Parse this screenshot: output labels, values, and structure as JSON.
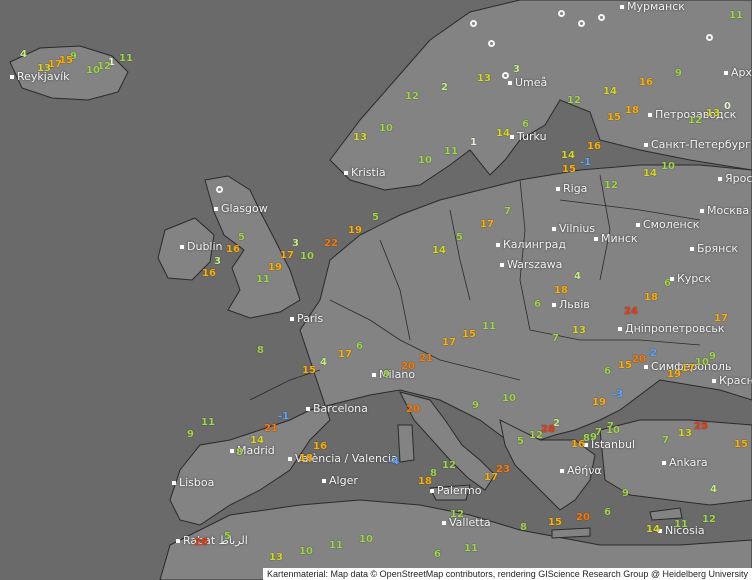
{
  "map": {
    "attribution": "Kartenmaterial: Map data © OpenStreetMap contributors, rendering GIScience Research Group @ Heidelberg University",
    "colors": {
      "sea": "#6a6a6a",
      "land": "#838383",
      "border": "#2a2a2a",
      "label": "#f2f2f2",
      "negative": "#5aa8ff",
      "cool": "#c6ee80",
      "mild": "#9fd64a",
      "warm": "#ffb000",
      "hot": "#f03a10"
    },
    "cities": [
      {
        "id": "reykjavik",
        "label": "Reykjavík"
      },
      {
        "id": "murmansk",
        "label": "Мурманск"
      },
      {
        "id": "arkhangelsk",
        "label": "Арха"
      },
      {
        "id": "petrozavodsk",
        "label": "Петрозаводск"
      },
      {
        "id": "umea",
        "label": "Umeå"
      },
      {
        "id": "turku",
        "label": "Turku"
      },
      {
        "id": "st-petersburg",
        "label": "Санкт-Петербург"
      },
      {
        "id": "kristiansand",
        "label": "Kristia"
      },
      {
        "id": "riga",
        "label": "Riga"
      },
      {
        "id": "yaroslavl",
        "label": "Яросл"
      },
      {
        "id": "glasgow",
        "label": "Glasgow"
      },
      {
        "id": "vilnius",
        "label": "Vilnius"
      },
      {
        "id": "minsk",
        "label": "Минск"
      },
      {
        "id": "smolensk",
        "label": "Смоленск"
      },
      {
        "id": "moskva",
        "label": "Москва"
      },
      {
        "id": "dublin",
        "label": "Dublin"
      },
      {
        "id": "bryansk",
        "label": "Брянск"
      },
      {
        "id": "kaliningrad",
        "label": "Калинград"
      },
      {
        "id": "warszawa",
        "label": "Warszawa"
      },
      {
        "id": "kursk",
        "label": "Курск"
      },
      {
        "id": "lviv",
        "label": "Львів"
      },
      {
        "id": "paris",
        "label": "Paris"
      },
      {
        "id": "dnipropetrovsk",
        "label": "Дніпропетровськ"
      },
      {
        "id": "simferopol",
        "label": "Симферополь"
      },
      {
        "id": "krasnodar",
        "label": "Красно"
      },
      {
        "id": "milano",
        "label": "Milano"
      },
      {
        "id": "barcelona",
        "label": "Barcelona"
      },
      {
        "id": "madrid",
        "label": "Madrid"
      },
      {
        "id": "valencia",
        "label": "València / Valencia"
      },
      {
        "id": "istanbul",
        "label": "İstanbul"
      },
      {
        "id": "ankara",
        "label": "Ankara"
      },
      {
        "id": "lisboa",
        "label": "Lisboa"
      },
      {
        "id": "palermo",
        "label": "Palermo"
      },
      {
        "id": "athina",
        "label": "Αθήνα"
      },
      {
        "id": "alger",
        "label": "Alger"
      },
      {
        "id": "valletta",
        "label": "Valletta"
      },
      {
        "id": "rabat",
        "label": "Rabat الرباط"
      },
      {
        "id": "nicosia",
        "label": "Nicosia"
      }
    ],
    "observations": [
      {
        "v": "4",
        "c": "c1"
      },
      {
        "v": "3",
        "c": "c1"
      },
      {
        "v": "6",
        "c": "c2"
      },
      {
        "v": "-1",
        "c": "neg"
      },
      {
        "v": "5",
        "c": "c2"
      },
      {
        "v": "7",
        "c": "c2"
      },
      {
        "v": "4",
        "c": "c1"
      },
      {
        "v": "6",
        "c": "c2"
      },
      {
        "v": "-3",
        "c": "neg"
      },
      {
        "v": "-2",
        "c": "neg"
      },
      {
        "v": "-1",
        "c": "neg"
      },
      {
        "v": "-4",
        "c": "neg"
      },
      {
        "v": "2",
        "c": "c1"
      },
      {
        "v": "4",
        "c": "c1"
      },
      {
        "v": "5",
        "c": "c2"
      },
      {
        "v": "6",
        "c": "c2"
      },
      {
        "v": "9",
        "c": "c2"
      },
      {
        "v": "9",
        "c": "c2"
      },
      {
        "v": "10",
        "c": "c2"
      },
      {
        "v": "10",
        "c": "c2"
      },
      {
        "v": "3",
        "c": "c1"
      },
      {
        "v": "5",
        "c": "c2"
      },
      {
        "v": "6",
        "c": "c2"
      },
      {
        "v": "8",
        "c": "c2"
      },
      {
        "v": "10",
        "c": "c2"
      },
      {
        "v": "9",
        "c": "c2"
      },
      {
        "v": "11",
        "c": "c2"
      },
      {
        "v": "12",
        "c": "c2"
      },
      {
        "v": "7",
        "c": "c2"
      },
      {
        "v": "9",
        "c": "c2"
      },
      {
        "v": "10",
        "c": "c2"
      },
      {
        "v": "12",
        "c": "c2"
      },
      {
        "v": "11",
        "c": "c2"
      },
      {
        "v": "13",
        "c": "c3"
      },
      {
        "v": "14",
        "c": "c3"
      },
      {
        "v": "15",
        "c": "w1"
      },
      {
        "v": "16",
        "c": "w1"
      },
      {
        "v": "17",
        "c": "w1"
      },
      {
        "v": "18",
        "c": "w1"
      },
      {
        "v": "17",
        "c": "w1"
      },
      {
        "v": "19",
        "c": "w1"
      },
      {
        "v": "20",
        "c": "w2"
      },
      {
        "v": "21",
        "c": "w2"
      },
      {
        "v": "23",
        "c": "w2"
      },
      {
        "v": "28",
        "c": "w3"
      },
      {
        "v": "25",
        "c": "w3"
      },
      {
        "v": "26",
        "c": "w3"
      },
      {
        "v": "20",
        "c": "w2"
      },
      {
        "v": "15",
        "c": "w1"
      },
      {
        "v": "16",
        "c": "w1"
      },
      {
        "v": "13",
        "c": "c3"
      },
      {
        "v": "14",
        "c": "c3"
      },
      {
        "v": "17",
        "c": "w1"
      },
      {
        "v": "19",
        "c": "w1"
      },
      {
        "v": "18",
        "c": "w1"
      },
      {
        "v": "21",
        "c": "w2"
      },
      {
        "v": "11",
        "c": "c2"
      },
      {
        "v": "10",
        "c": "c2"
      },
      {
        "v": "9",
        "c": "c2"
      },
      {
        "v": "8",
        "c": "c2"
      },
      {
        "v": "7",
        "c": "c2"
      },
      {
        "v": "10",
        "c": "c2"
      },
      {
        "v": "11",
        "c": "c2"
      },
      {
        "v": "12",
        "c": "c2"
      },
      {
        "v": "1",
        "c": "c0"
      },
      {
        "v": "2",
        "c": "c1"
      },
      {
        "v": "1",
        "c": "c0"
      },
      {
        "v": "0",
        "c": "c0"
      },
      {
        "v": "3",
        "c": "c1"
      },
      {
        "v": "5",
        "c": "c2"
      },
      {
        "v": "6",
        "c": "c2"
      },
      {
        "v": "4",
        "c": "c1"
      },
      {
        "v": "13",
        "c": "c3"
      },
      {
        "v": "15",
        "c": "w1"
      },
      {
        "v": "14",
        "c": "c3"
      },
      {
        "v": "17",
        "c": "w1"
      },
      {
        "v": "12",
        "c": "c2"
      },
      {
        "v": "13",
        "c": "c3"
      },
      {
        "v": "11",
        "c": "c2"
      },
      {
        "v": "15",
        "c": "w1"
      },
      {
        "v": "17",
        "c": "w1"
      },
      {
        "v": "14",
        "c": "c3"
      },
      {
        "v": "16",
        "c": "w1"
      },
      {
        "v": "18",
        "c": "w1"
      },
      {
        "v": "19",
        "c": "w1"
      },
      {
        "v": "22",
        "c": "w2"
      },
      {
        "v": "24",
        "c": "w3"
      },
      {
        "v": "20",
        "c": "w2"
      },
      {
        "v": "15",
        "c": "w1"
      },
      {
        "v": "17",
        "c": "w1"
      },
      {
        "v": "16",
        "c": "w1"
      },
      {
        "v": "18",
        "c": "w1"
      },
      {
        "v": "8",
        "c": "c2"
      },
      {
        "v": "9",
        "c": "c2"
      },
      {
        "v": "10",
        "c": "c2"
      },
      {
        "v": "11",
        "c": "c2"
      },
      {
        "v": "12",
        "c": "c2"
      },
      {
        "v": "12",
        "c": "c2"
      },
      {
        "v": "11",
        "c": "c2"
      },
      {
        "v": "13",
        "c": "c3"
      },
      {
        "v": "16",
        "c": "w1"
      },
      {
        "v": "14",
        "c": "c3"
      },
      {
        "v": "17",
        "c": "w1"
      },
      {
        "v": "15",
        "c": "w1"
      },
      {
        "v": "7",
        "c": "c2"
      },
      {
        "v": "6",
        "c": "c2"
      },
      {
        "v": "8",
        "c": "c2"
      },
      {
        "v": "9",
        "c": "c2"
      },
      {
        "v": "5",
        "c": "c2"
      },
      {
        "v": "7",
        "c": "c2"
      },
      {
        "v": "6",
        "c": "c2"
      },
      {
        "v": "8",
        "c": "c2"
      },
      {
        "v": "13",
        "c": "c3"
      },
      {
        "v": "12",
        "c": "c2"
      },
      {
        "v": "14",
        "c": "c3"
      },
      {
        "v": "15",
        "c": "w1"
      },
      {
        "v": "11",
        "c": "c2"
      },
      {
        "v": "10",
        "c": "c2"
      },
      {
        "v": "12",
        "c": "c2"
      },
      {
        "v": "9",
        "c": "c2"
      },
      {
        "v": "17",
        "c": "w1"
      },
      {
        "v": "19",
        "c": "w1"
      },
      {
        "v": "18",
        "c": "w1"
      },
      {
        "v": "20",
        "c": "w2"
      },
      {
        "v": "16",
        "c": "w1"
      },
      {
        "v": "15",
        "c": "w1"
      },
      {
        "v": "13",
        "c": "c3"
      },
      {
        "v": "14",
        "c": "c3"
      },
      {
        "v": "10",
        "c": "c2"
      },
      {
        "v": "11",
        "c": "c2"
      },
      {
        "v": "10",
        "c": "c2"
      },
      {
        "v": "12",
        "c": "c2"
      }
    ]
  }
}
